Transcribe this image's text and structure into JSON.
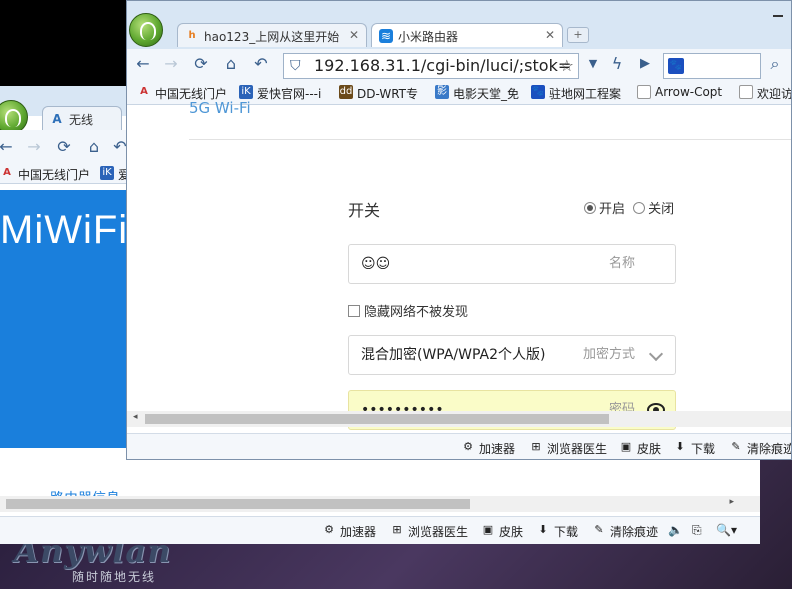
{
  "back_window": {
    "tabs": [
      {
        "label": "无线"
      }
    ],
    "bookmarks": [
      {
        "label": "中国无线门户"
      },
      {
        "label": "爱"
      }
    ],
    "banner_text": "MiWiFi",
    "router_info_text": "路由器信息",
    "statusbar": [
      {
        "label": "加速器"
      },
      {
        "label": "浏览器医生"
      },
      {
        "label": "皮肤"
      },
      {
        "label": "下载"
      },
      {
        "label": "清除痕迹"
      }
    ]
  },
  "front_window": {
    "tabs": [
      {
        "label": "hao123_上网从这里开始",
        "active": false
      },
      {
        "label": "小米路由器",
        "active": true
      }
    ],
    "url": "192.168.31.1/cgi-bin/luci/;stok=",
    "search_value": "",
    "bookmarks": [
      {
        "label": "中国无线门户"
      },
      {
        "label": "爱快官网---i"
      },
      {
        "label": "DD-WRT专"
      },
      {
        "label": "电影天堂_免"
      },
      {
        "label": "驻地网工程案"
      },
      {
        "label": "Arrow-Copt"
      },
      {
        "label": "欢迎访"
      }
    ],
    "section_title": "5G Wi-Fi",
    "switch_label": "开关",
    "radio_on_label": "开启",
    "radio_off_label": "关闭",
    "ssid_value": "☺☺",
    "ssid_hint": "名称",
    "hide_network_label": "隐藏网络不被发现",
    "encryption_value": "混合加密(WPA/WPA2个人版)",
    "encryption_hint": "加密方式",
    "password_value": "••••••••••",
    "password_hint": "密码",
    "statusbar": [
      {
        "label": "加速器"
      },
      {
        "label": "浏览器医生"
      },
      {
        "label": "皮肤"
      },
      {
        "label": "下载"
      },
      {
        "label": "清除痕迹"
      }
    ]
  },
  "watermark": {
    "brand": "Anywlan",
    "tagline": "随时随地无线"
  },
  "colors": {
    "miwifi_blue": "#1a7fdc",
    "chrome_blue": "#d8e6f4",
    "password_fill": "#fafcc8"
  }
}
